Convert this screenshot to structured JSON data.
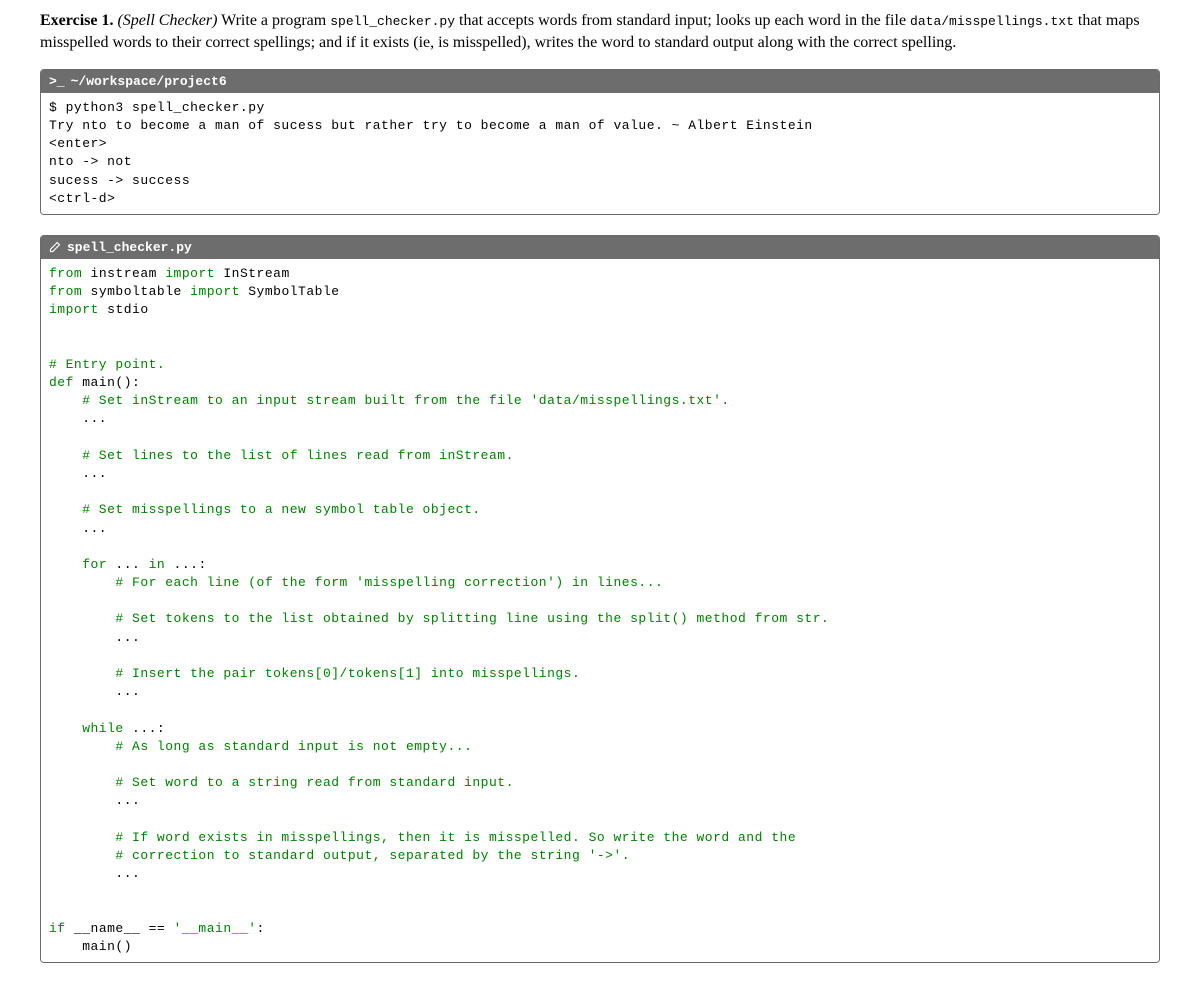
{
  "exercise": {
    "label": "Exercise 1.",
    "title_italic": "(Spell Checker)",
    "program_file": "spell_checker.py",
    "data_file": "data/misspellings.txt",
    "text_prefix": " Write a program ",
    "text_mid1": " that accepts words from standard input; looks up each word in the file ",
    "text_mid2": " that maps misspelled words to their correct spellings; and if it exists (ie, is misspelled), writes the word to standard output along with the correct spelling."
  },
  "terminal": {
    "prompt_icon": ">_",
    "path": "~/workspace/project6",
    "lines": [
      "$ python3 spell_checker.py",
      "Try nto to become a man of sucess but rather try to become a man of value. ~ Albert Einstein",
      "<enter>",
      "nto -> not",
      "sucess -> success",
      "<ctrl-d>"
    ]
  },
  "editor": {
    "filename": "spell_checker.py",
    "code": {
      "l1": {
        "kw1": "from",
        "mod1": " instream ",
        "kw2": "import",
        "cls1": " InStream"
      },
      "l2": {
        "kw1": "from",
        "mod1": " symboltable ",
        "kw2": "import",
        "cls1": " SymbolTable"
      },
      "l3": {
        "kw1": "import",
        "mod1": " stdio"
      },
      "c_entry": "# Entry point.",
      "def_main": {
        "kw": "def",
        "name": " main():"
      },
      "c_instream": "    # Set inStream to an input stream built from the file 'data/misspellings.txt'.",
      "dots1": "    ...",
      "c_lines": "    # Set lines to the list of lines read from inStream.",
      "dots2": "    ...",
      "c_miss": "    # Set misspellings to a new symbol table object.",
      "dots3": "    ...",
      "for_line": {
        "kw1": "    for",
        "mid": " ... ",
        "kw2": "in",
        "end": " ...:"
      },
      "c_for": "        # For each line (of the form 'misspelling correction') in lines...",
      "c_tokens": "        # Set tokens to the list obtained by splitting line using the split() method from str.",
      "dots4": "        ...",
      "c_insert": "        # Insert the pair tokens[0]/tokens[1] into misspellings.",
      "dots5": "        ...",
      "while_line": {
        "kw": "    while",
        "end": " ...:"
      },
      "c_while": "        # As long as standard input is not empty...",
      "c_word": "        # Set word to a string read from standard input.",
      "dots6": "        ...",
      "c_if1": "        # If word exists in misspellings, then it is misspelled. So write the word and the",
      "c_if2": "        # correction to standard output, separated by the string '->'.",
      "dots7": "        ...",
      "if_name": {
        "kw": "if",
        "mid": " __name__ == ",
        "str": "'__main__'",
        "end": ":"
      },
      "call_main": "    main()"
    }
  }
}
